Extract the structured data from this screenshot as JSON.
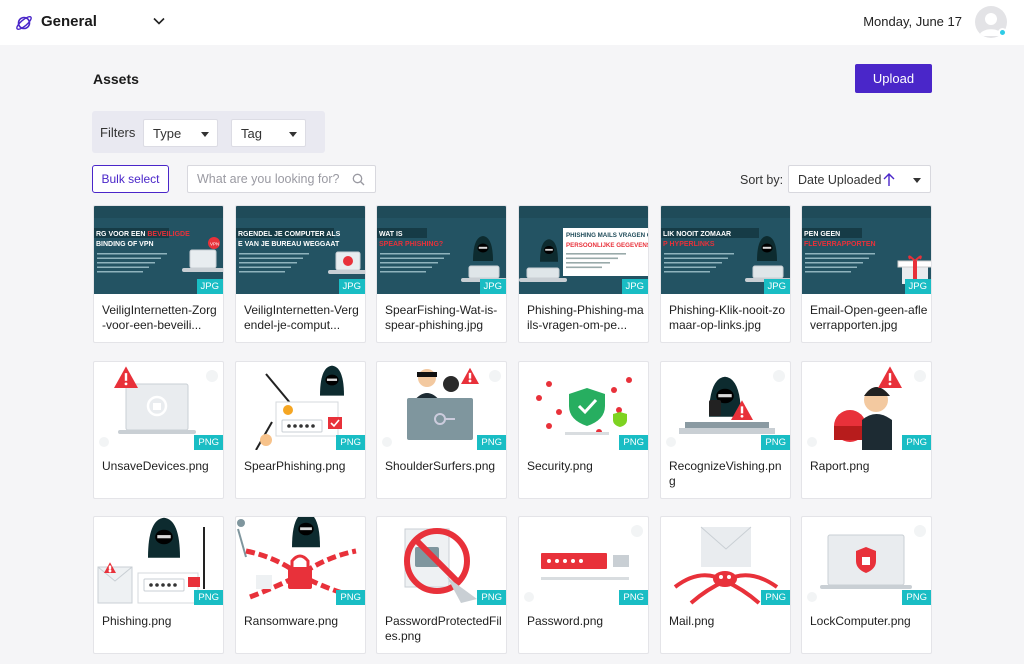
{
  "header": {
    "workspace": "General",
    "date": "Monday, June 17"
  },
  "page": {
    "title": "Assets",
    "upload_label": "Upload"
  },
  "filters": {
    "label": "Filters",
    "type": "Type",
    "tag": "Tag"
  },
  "toolbar": {
    "bulk_select": "Bulk select",
    "search_placeholder": "What are you looking for?",
    "sort_label": "Sort by:",
    "sort_value": "Date Uploaded"
  },
  "assets": [
    {
      "name": "VeiligInternetten-Zorg-voor-een-beveili...",
      "format": "JPG",
      "kind": "banner",
      "caption1": "RG VOOR EEN",
      "caption1b": "BEVEILIGDE",
      "caption2": "BINDING OF VPN",
      "icon": "vpn"
    },
    {
      "name": "VeiligInternetten-Vergendel-je-comput...",
      "format": "JPG",
      "kind": "banner",
      "caption1": "RGENDEL JE COMPUTER ALS",
      "caption1b": "",
      "caption2": "E VAN JE BUREAU WEGGAAT",
      "icon": "lock"
    },
    {
      "name": "SpearFishing-Wat-is-spear-phishing.jpg",
      "format": "JPG",
      "kind": "banner",
      "caption1": "WAT IS",
      "caption1b": "",
      "caption2": "SPEAR PHISHING?",
      "icon": "hacker"
    },
    {
      "name": "Phishing-Phishing-mails-vragen-om-pe...",
      "format": "JPG",
      "kind": "banner-light",
      "caption1": "PHISHING MAILS VRAGEN OM",
      "caption1b": "",
      "caption2": "PERSOONLIJKE GEGEVENS",
      "icon": "hacker"
    },
    {
      "name": "Phishing-Klik-nooit-zomaar-op-links.jpg",
      "format": "JPG",
      "kind": "banner",
      "caption1": "LIK NOOIT ZOMAAR",
      "caption1b": "",
      "caption2": "P HYPERLINKS",
      "icon": "hacker"
    },
    {
      "name": "Email-Open-geen-afleverrapporten.jpg",
      "format": "JPG",
      "kind": "banner",
      "caption1": "PEN GEEN",
      "caption1b": "",
      "caption2": "FLEVERRAPPORTEN",
      "icon": "gift"
    },
    {
      "name": "UnsaveDevices.png",
      "format": "PNG",
      "kind": "unsafe-devices"
    },
    {
      "name": "SpearPhishing.png",
      "format": "PNG",
      "kind": "spear-phishing"
    },
    {
      "name": "ShoulderSurfers.png",
      "format": "PNG",
      "kind": "shoulder-surfers"
    },
    {
      "name": "Security.png",
      "format": "PNG",
      "kind": "security"
    },
    {
      "name": "RecognizeVishing.png",
      "format": "PNG",
      "kind": "vishing"
    },
    {
      "name": "Raport.png",
      "format": "PNG",
      "kind": "raport"
    },
    {
      "name": "Phishing.png",
      "format": "PNG",
      "kind": "phishing"
    },
    {
      "name": "Ransomware.png",
      "format": "PNG",
      "kind": "ransomware"
    },
    {
      "name": "PasswordProtectedFiles.png",
      "format": "PNG",
      "kind": "password-files"
    },
    {
      "name": "Password.png",
      "format": "PNG",
      "kind": "password"
    },
    {
      "name": "Mail.png",
      "format": "PNG",
      "kind": "mail"
    },
    {
      "name": "LockComputer.png",
      "format": "PNG",
      "kind": "lock-computer"
    }
  ],
  "colors": {
    "accent": "#4a26c9",
    "badge": "#19bdc4",
    "banner_bg": "#1f4b59",
    "alert_red": "#e8313a"
  }
}
